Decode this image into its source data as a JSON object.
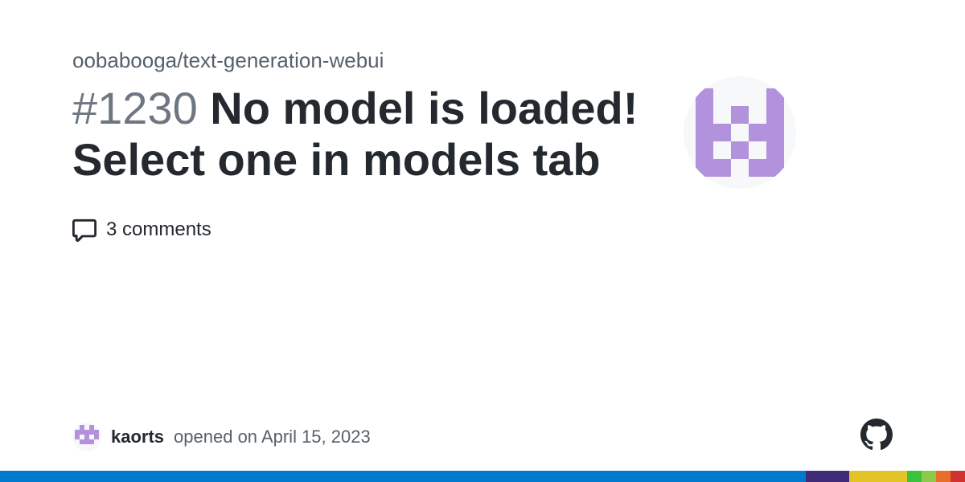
{
  "repo": "oobabooga/text-generation-webui",
  "issue_number": "#1230",
  "title": "No model is loaded! Select one in models tab",
  "comments_label": "3 comments",
  "author": "kaorts",
  "opened_text": "opened on April 15, 2023",
  "language_bar": [
    {
      "color": "#007acc",
      "width": "83.5%"
    },
    {
      "color": "#3f2b78",
      "width": "4.5%"
    },
    {
      "color": "#e3c427",
      "width": "6%"
    },
    {
      "color": "#3ac23a",
      "width": "1.5%"
    },
    {
      "color": "#8bc94a",
      "width": "1.5%"
    },
    {
      "color": "#e86f2a",
      "width": "1.5%"
    },
    {
      "color": "#d0332f",
      "width": "1.5%"
    }
  ]
}
